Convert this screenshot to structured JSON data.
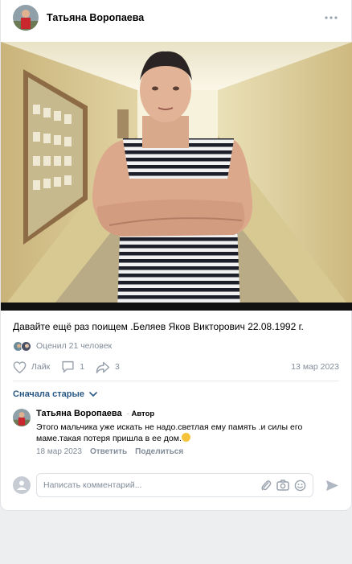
{
  "post": {
    "author": "Татьяна Воропаева",
    "text": "Давайте ещё раз поищем .Беляев Яков Викторович 22.08.1992 г.",
    "rated": "Оценил 21 человек",
    "date": "13 мар 2023",
    "actions": {
      "like_label": "Лайк",
      "comments_count": "1",
      "shares_count": "3"
    }
  },
  "comments": {
    "sort_label": "Сначала старые",
    "items": [
      {
        "author": "Татьяна Воропаева",
        "badge_dot": "·",
        "badge": "Автор",
        "text": "Этого мальчика уже искать не надо.светлая ему память .и силы его маме.такая потеря пришла в ее дом.",
        "date": "18 мар 2023",
        "reply": "Ответить",
        "share": "Поделиться"
      }
    ]
  },
  "compose": {
    "placeholder": "Написать комментарий..."
  },
  "colors": {
    "link": "#2a5885",
    "secondary_text": "#818c99",
    "page_bg": "#edeef0"
  }
}
